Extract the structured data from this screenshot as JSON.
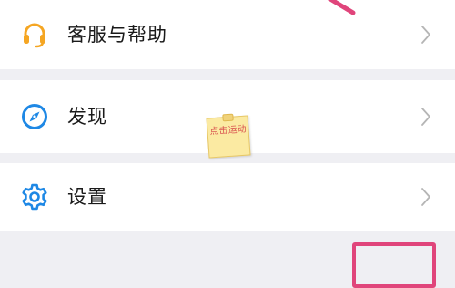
{
  "menu": {
    "items": [
      {
        "id": "service",
        "label": "客服与帮助",
        "icon": "headset-icon",
        "icon_color": "#f5a623"
      },
      {
        "id": "discover",
        "label": "发现",
        "icon": "compass-icon",
        "icon_color": "#1e88e5"
      },
      {
        "id": "settings",
        "label": "设置",
        "icon": "gear-icon",
        "icon_color": "#1e88e5"
      }
    ]
  },
  "annotation": {
    "sticky_note_text": "点击运动",
    "highlight_color": "#e0457b",
    "note_color": "#fbeaa2"
  },
  "colors": {
    "background": "#efeff3",
    "card": "#ffffff",
    "text": "#1a1a1a",
    "chevron": "#b5b5b5"
  }
}
